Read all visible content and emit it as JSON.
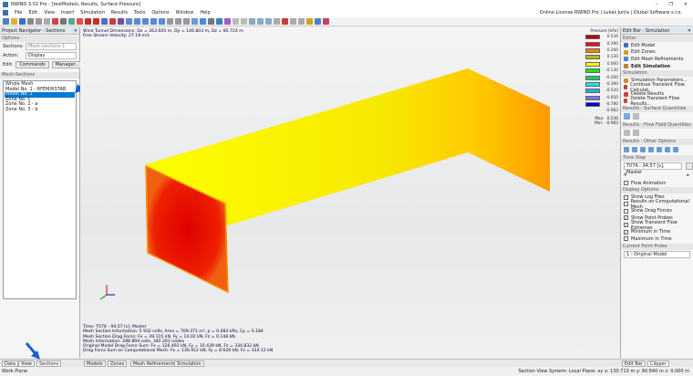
{
  "window": {
    "title": "RWIND 3.02 Pro - [testModels, Results, Surface Pressure]",
    "controls": [
      "–",
      "❐",
      "✕"
    ]
  },
  "menu": {
    "items": [
      "File",
      "Edit",
      "View",
      "Insert",
      "Simulation",
      "Results",
      "Tools",
      "Options",
      "Window",
      "Help"
    ],
    "license": "Online License RWIND Pro | Lukáš Jurča | Dlubal Software s.r.o."
  },
  "navigator": {
    "title": "Project Navigator - Sections",
    "options_header": "Options",
    "sections_label": "Sections:",
    "sections_value": "Mesh-sections 1",
    "action_label": "Action:",
    "action_value": "Display",
    "edit_label": "Edit:",
    "commands_btn": "Commands",
    "manager_btn": "Manager...",
    "mesh_header": "Mesh-Sections",
    "mesh_items": [
      "Whole Mesh",
      "Model No. 1 - RFEM/RSTAB Model",
      "Model No. 1",
      "Zone No. 1",
      "Zone No. 2 - a",
      "Zone No. 3 - b"
    ],
    "selected_index": 2
  },
  "viewport": {
    "top_info": [
      "Wind Tunnel Dimensions: Dx = 263.605 m, Dy = 146.803 m, Dz = 85.724 m",
      "Free Stream Velocity: 27.18 m/s"
    ],
    "bottom_info": [
      "Time: T074 - 94.57 [s], Master",
      "Mesh Section Information: 5 932 cells, Area = 709.371 m², p = 0.083 kPa, Cp = 0.184",
      "Mesh Section Drag Force: Fx = 39.115 kN, Fy = 14.02 kN, Fz = 0.148 kN",
      "Mesh Information: 288 894 cells, 340 261 nodes",
      "Original Model Drag Force Sum: Fx = 126.492 kN, Fy = 10.439 kN, Fz = 334.832 kN",
      "Drag Force Sum on Computational Mesh: Fx = 136.912 kN, Fy = 8.626 kN, Fz = 334.12 kN"
    ]
  },
  "legend": {
    "title": "Pressure [kPa]",
    "values": [
      "0.536",
      "0.390",
      "0.260",
      "0.130",
      "0.000",
      "-0.130",
      "-0.260",
      "-0.390",
      "-0.520",
      "-0.650",
      "-0.780",
      "-0.983"
    ],
    "colors": [
      "#b00000",
      "#ee1010",
      "#f08000",
      "#c8b400",
      "#ffff00",
      "#20e020",
      "#20c878",
      "#10e8e8",
      "#30a8f0",
      "#7878e0",
      "#0000d8"
    ],
    "max_label": "Max:",
    "max_value": "0.536",
    "min_label": "Min:",
    "min_value": "-0.983"
  },
  "editbar": {
    "title": "Edit Bar - Simulation",
    "editor_header": "Editor",
    "editor_items": [
      "Edit Model",
      "Edit Zones",
      "Edit Mesh Refinements",
      "Edit Simulation"
    ],
    "simulation_header": "Simulation",
    "simulation_items": [
      "Simulation Parameters...",
      "Continue Transient Flow Calculat...",
      "Delete Results",
      "Delete Transient Flow Results..."
    ],
    "surface_header": "Results - Surface Quantities",
    "flow_header": "Results - Flow Field Quantities",
    "other_header": "Results - Other Options",
    "timestep_header": "Time Step",
    "timestep_value": "T074 - 94.57 [s], Master",
    "timestep_index": "4",
    "flow_animation": "Flow Animation",
    "display_header": "Display Options",
    "display_options": [
      {
        "label": "Show Log Files",
        "checked": false
      },
      {
        "label": "Results on Computational Mesh",
        "checked": false
      },
      {
        "label": "Show Drag Forces",
        "checked": false
      },
      {
        "label": "Show Point Probes",
        "checked": true
      },
      {
        "label": "Show Transient Flow Extremes",
        "checked": true
      },
      {
        "label": "Minimum in Time",
        "checked": true
      },
      {
        "label": "Maximum in Time",
        "checked": false
      }
    ],
    "probe_header": "Current Point Probe",
    "probe_value": "1 - Original Model"
  },
  "tabs": {
    "left": [
      "Data",
      "View",
      "Sections"
    ],
    "main": [
      "Models",
      "Zones",
      "Mesh Refinements",
      "Simulation"
    ],
    "right": [
      "Edit Bar",
      "Clipper"
    ]
  },
  "status": {
    "left": "Work Plane",
    "right": "Section View   System: Local   Plane: xy   x: 130.713 m   y: 90.640 m   z: 0.000 m"
  },
  "accent": "#0078d7"
}
